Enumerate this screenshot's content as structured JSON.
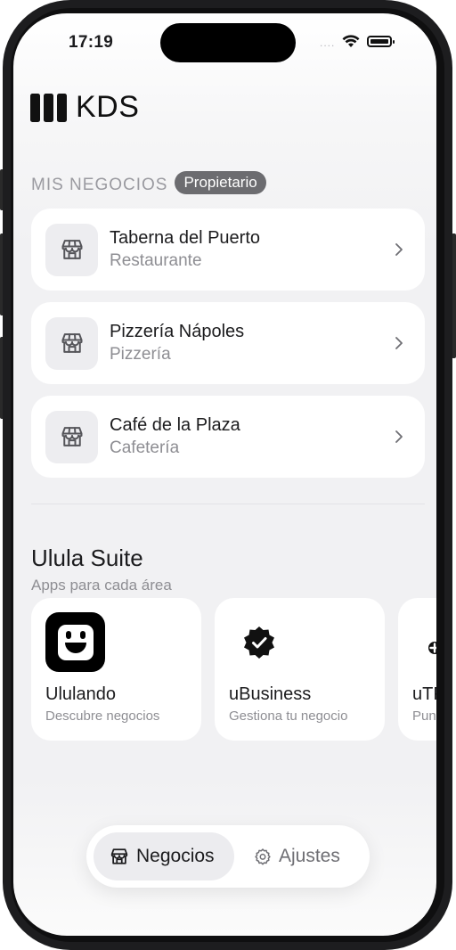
{
  "status_bar": {
    "time": "17:19",
    "signal": "...."
  },
  "header": {
    "title": "KDS",
    "logo_icon": "kds-logo-icon"
  },
  "businesses": {
    "section_title": "MIS NEGOCIOS",
    "role_badge": "Propietario",
    "items": [
      {
        "name": "Taberna del Puerto",
        "type": "Restaurante",
        "icon": "store-icon"
      },
      {
        "name": "Pizzería Nápoles",
        "type": "Pizzería",
        "icon": "store-icon"
      },
      {
        "name": "Café de la Plaza",
        "type": "Cafetería",
        "icon": "store-icon"
      }
    ]
  },
  "suite": {
    "title": "Ulula Suite",
    "subtitle": "Apps para cada área",
    "apps": [
      {
        "name": "Ululando",
        "description": "Descubre negocios",
        "icon": "ululando-logo-icon",
        "icon_bg": "#000000"
      },
      {
        "name": "uBusiness",
        "description": "Gestiona tu negocio",
        "icon": "verified-badge-icon",
        "icon_bg": "#ffffff"
      },
      {
        "name": "uTPV",
        "description": "Punto de venta",
        "icon": "pos-terminal-icon",
        "icon_bg": "#ffffff"
      }
    ]
  },
  "tabbar": {
    "tabs": [
      {
        "label": "Negocios",
        "icon": "store-icon",
        "active": true
      },
      {
        "label": "Ajustes",
        "icon": "gear-icon",
        "active": false
      }
    ]
  },
  "colors": {
    "accent": "#1c1c1e",
    "badge_bg": "#6c6c70",
    "muted_text": "#8e8e93",
    "card_bg": "#ffffff"
  }
}
